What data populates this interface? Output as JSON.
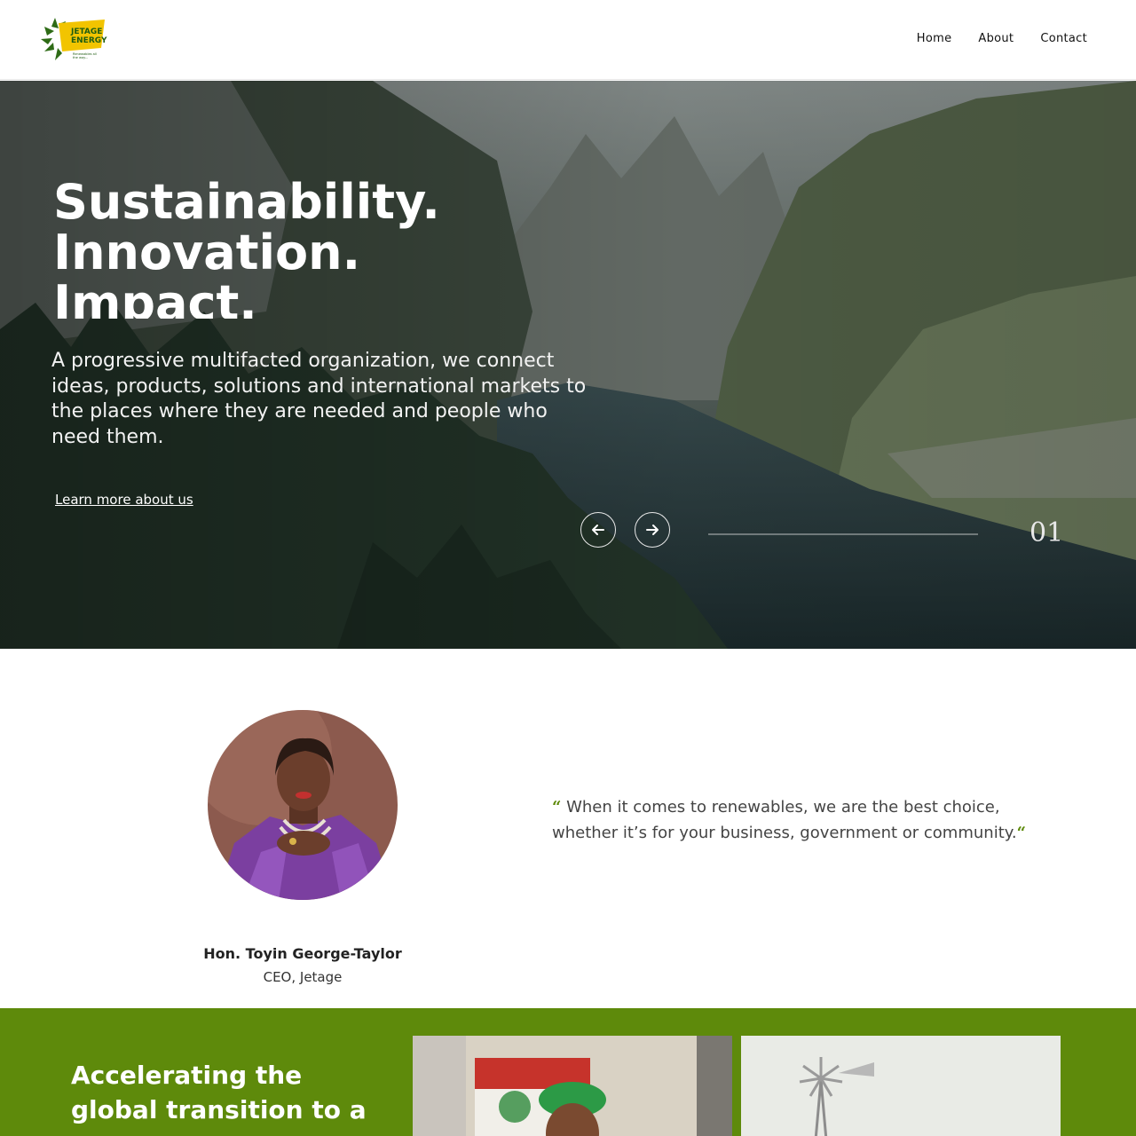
{
  "header": {
    "logo_alt": "Jetage Energy logo",
    "logo_text_1": "JETAGE",
    "logo_text_2": "ENERGY",
    "logo_tagline": "Renewables all the way...",
    "nav": [
      {
        "label": "Home"
      },
      {
        "label": "About"
      },
      {
        "label": "Contact"
      }
    ]
  },
  "hero": {
    "title_lines": [
      "Sustainability.",
      "Innovation.",
      "Impact."
    ],
    "subtitle": "A progressive multifacted organization, we connect ideas, products, solutions and international markets to the places where they are needed and people who need them.",
    "cta": "Learn more about us",
    "prev_icon": "arrow-left-icon",
    "next_icon": "arrow-right-icon",
    "slide_number": "01",
    "progress": 0.0
  },
  "testimonial": {
    "name": "Hon. Toyin George-Taylor",
    "role": "CEO, Jetage",
    "open_quote": "“",
    "close_quote": "“",
    "quote": "When it comes to renewables, we are the best choice, whether it’s for your business, government or community."
  },
  "mission": {
    "heading": "Accelerating the global transition to a green"
  },
  "colors": {
    "brand_green": "#5e8a0b",
    "logo_yellow": "#f2c400"
  }
}
